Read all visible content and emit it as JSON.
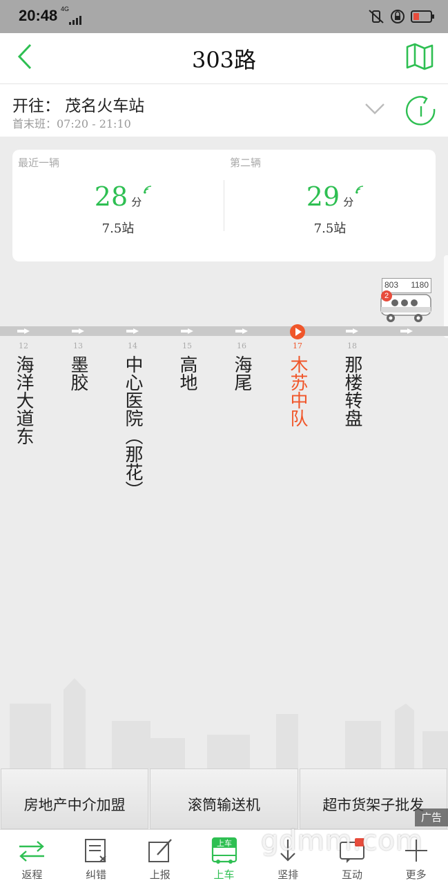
{
  "status_bar": {
    "time": "20:48",
    "network": "4G"
  },
  "header": {
    "title": "303路"
  },
  "direction": {
    "to": "开往： 茂名火车站",
    "hours": "首末班：07:20 - 21:10"
  },
  "arrivals": [
    {
      "label": "最近一辆",
      "minutes": "28",
      "unit": "分",
      "stops": "7.5站"
    },
    {
      "label": "第二辆",
      "minutes": "29",
      "unit": "分",
      "stops": "7.5站"
    }
  ],
  "bus": {
    "plate_left": "803",
    "plate_right": "1180",
    "count": "2"
  },
  "stations": [
    {
      "index": "12",
      "name": "海洋大道东"
    },
    {
      "index": "13",
      "name": "墨胶"
    },
    {
      "index": "14",
      "name": "中心医院（那花）"
    },
    {
      "index": "15",
      "name": "高地"
    },
    {
      "index": "16",
      "name": "海尾"
    },
    {
      "index": "17",
      "name": "木苏中队",
      "current": true
    },
    {
      "index": "18",
      "name": "那楼转盘"
    }
  ],
  "ads": [
    "房地产中介加盟",
    "滚筒输送机",
    "超市货架子批发"
  ],
  "ad_tag": "广告",
  "tabs": [
    {
      "label": "返程",
      "icon": "swap-arrows-icon"
    },
    {
      "label": "纠错",
      "icon": "edit-list-icon"
    },
    {
      "label": "上报",
      "icon": "pencil-report-icon"
    },
    {
      "label": "上车",
      "icon": "board-bus-icon",
      "active": true
    },
    {
      "label": "坚排",
      "icon": "sort-down-icon"
    },
    {
      "label": "互动",
      "icon": "chat-icon"
    },
    {
      "label": "更多",
      "icon": "plus-icon"
    }
  ],
  "tab_board_icon_text": "上车",
  "watermark": "gdmm.com",
  "colors": {
    "accent": "#2ebf52",
    "current_station": "#f0562a"
  }
}
